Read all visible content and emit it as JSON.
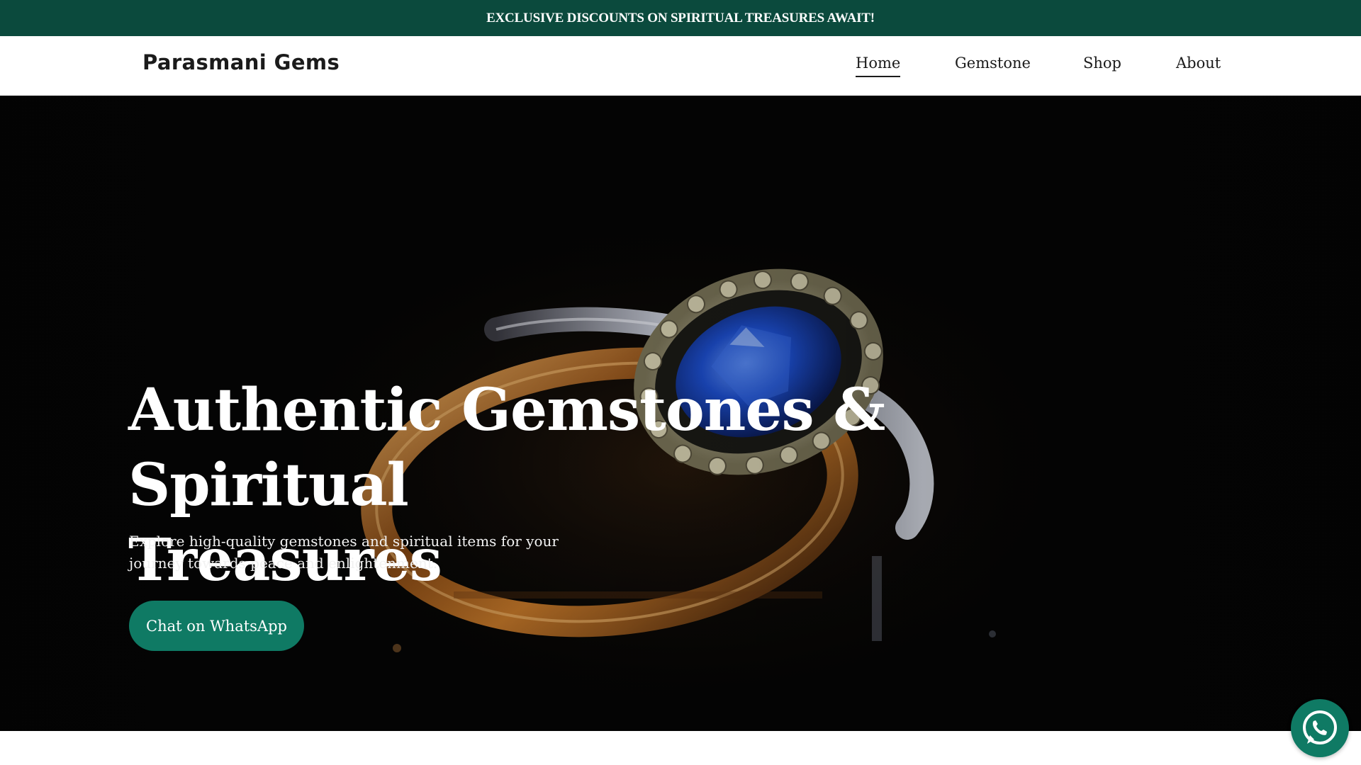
{
  "announcement": {
    "text": "EXCLUSIVE DISCOUNTS ON SPIRITUAL TREASURES AWAIT!"
  },
  "header": {
    "brand": "Parasmani Gems",
    "nav": [
      {
        "label": "Home",
        "active": true
      },
      {
        "label": "Gemstone",
        "active": false
      },
      {
        "label": "Shop",
        "active": false
      },
      {
        "label": "About",
        "active": false
      }
    ]
  },
  "hero": {
    "title_line1": "Authentic Gemstones & Spiritual",
    "title_line2": "Treasures",
    "subtitle_line1": "Explore high-quality gemstones and spiritual items for your",
    "subtitle_line2": "journey towards peace and enlightenment.",
    "cta_label": "Chat on WhatsApp",
    "background_image": "ring-with-blue-gemstone-photo"
  },
  "floating_button": {
    "icon": "whatsapp-icon"
  },
  "colors": {
    "announcement_bg": "#0b4a3d",
    "accent": "#0f7a64",
    "text_dark": "#1b1b1b"
  }
}
